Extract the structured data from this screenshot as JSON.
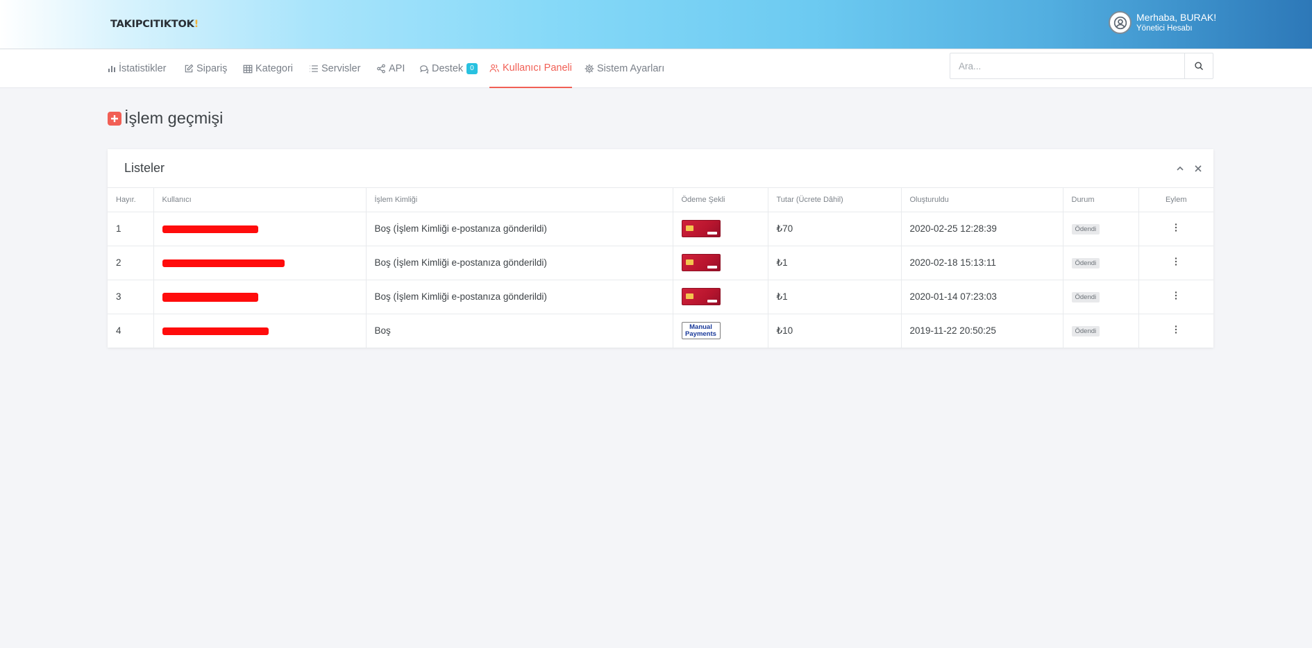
{
  "app": {
    "logo_text": "TAKIPCITIKTOK",
    "logo_tail": "!"
  },
  "user": {
    "greeting": "Merhaba, BURAK!",
    "role": "Yönetici Hesabı"
  },
  "nav": {
    "items": [
      {
        "label": "İstatistikler",
        "icon": "bar-chart-icon"
      },
      {
        "label": "Sipariş",
        "icon": "edit-icon"
      },
      {
        "label": "Kategori",
        "icon": "table-icon"
      },
      {
        "label": "Servisler",
        "icon": "list-icon"
      },
      {
        "label": "API",
        "icon": "share-icon"
      },
      {
        "label": "Destek",
        "icon": "chat-icon",
        "badge": "0"
      },
      {
        "label": "Kullanıcı Paneli",
        "icon": "users-icon",
        "active": true
      },
      {
        "label": "Sistem Ayarları",
        "icon": "gear-icon"
      }
    ]
  },
  "search": {
    "placeholder": "Ara..."
  },
  "page": {
    "title": "İşlem geçmişi"
  },
  "card": {
    "title": "Listeler"
  },
  "table": {
    "headers": [
      "Hayır.",
      "Kullanıcı",
      "İşlem Kimliği",
      "Ödeme Şekli",
      "Tutar (Ücrete Dâhil)",
      "Oluşturuldu",
      "Durum",
      "Eylem"
    ],
    "rows": [
      {
        "no": "1",
        "transaction": "Boş (İşlem Kimliği e-postanıza gönderildi)",
        "payment": "credit-card",
        "amount": "₺70",
        "created": "2020-02-25 12:28:39",
        "status": "Ödendi"
      },
      {
        "no": "2",
        "transaction": "Boş (İşlem Kimliği e-postanıza gönderildi)",
        "payment": "credit-card",
        "amount": "₺1",
        "created": "2020-02-18 15:13:11",
        "status": "Ödendi"
      },
      {
        "no": "3",
        "transaction": "Boş (İşlem Kimliği e-postanıza gönderildi)",
        "payment": "credit-card",
        "amount": "₺1",
        "created": "2020-01-14 07:23:03",
        "status": "Ödendi"
      },
      {
        "no": "4",
        "transaction": "Boş",
        "payment": "manual-payments",
        "payment_text": [
          "Manual",
          "Payments"
        ],
        "amount": "₺10",
        "created": "2019-11-22 20:50:25",
        "status": "Ödendi"
      }
    ]
  },
  "colors": {
    "accent": "#f15f55",
    "badge": "#28c1e0",
    "redaction": "#ff0c0c"
  }
}
